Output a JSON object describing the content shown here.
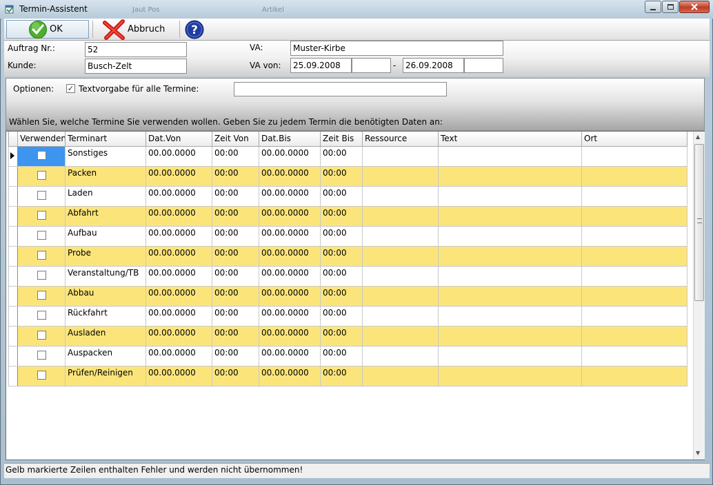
{
  "window": {
    "title": "Termin-Assistent",
    "background_caption_1": "Jaut Pos",
    "background_caption_2": "Artikel"
  },
  "toolbar": {
    "ok_label": "OK",
    "cancel_label": "Abbruch",
    "ok_icon": "green-check-icon",
    "cancel_icon": "red-x-icon",
    "help_icon": "help-question-icon"
  },
  "header": {
    "order_label": "Auftrag Nr.:",
    "order_value": "52",
    "customer_label": "Kunde:",
    "customer_value": "Busch-Zelt",
    "event_label": "VA:",
    "event_value": "Muster-Kirbe",
    "event_from_label": "VA von:",
    "date_from": "25.09.2008",
    "time_from": "",
    "date_separator": "-",
    "date_to": "26.09.2008",
    "time_to": ""
  },
  "options": {
    "label": "Optionen:",
    "text_default_checkbox_label": "Textvorgabe für alle Termine:",
    "text_default_checked": true,
    "text_default_value": "",
    "instruction": "Wählen Sie, welche Termine Sie verwenden wollen. Geben Sie zu jedem Termin die benötigten Daten an:"
  },
  "grid": {
    "columns": [
      "Verwenden",
      "Terminart",
      "Dat.Von",
      "Zeit Von",
      "Dat.Bis",
      "Zeit Bis",
      "Ressource",
      "Text",
      "Ort"
    ],
    "rows": [
      {
        "use": false,
        "type": "Sonstiges",
        "date_from": "00.00.0000",
        "time_from": "00:00",
        "date_to": "00.00.0000",
        "time_to": "00:00",
        "resource": "",
        "text": "",
        "place": ""
      },
      {
        "use": false,
        "type": "Packen",
        "date_from": "00.00.0000",
        "time_from": "00:00",
        "date_to": "00.00.0000",
        "time_to": "00:00",
        "resource": "",
        "text": "",
        "place": ""
      },
      {
        "use": false,
        "type": "Laden",
        "date_from": "00.00.0000",
        "time_from": "00:00",
        "date_to": "00.00.0000",
        "time_to": "00:00",
        "resource": "",
        "text": "",
        "place": ""
      },
      {
        "use": false,
        "type": "Abfahrt",
        "date_from": "00.00.0000",
        "time_from": "00:00",
        "date_to": "00.00.0000",
        "time_to": "00:00",
        "resource": "",
        "text": "",
        "place": ""
      },
      {
        "use": false,
        "type": "Aufbau",
        "date_from": "00.00.0000",
        "time_from": "00:00",
        "date_to": "00.00.0000",
        "time_to": "00:00",
        "resource": "",
        "text": "",
        "place": ""
      },
      {
        "use": false,
        "type": "Probe",
        "date_from": "00.00.0000",
        "time_from": "00:00",
        "date_to": "00.00.0000",
        "time_to": "00:00",
        "resource": "",
        "text": "",
        "place": ""
      },
      {
        "use": false,
        "type": "Veranstaltung/TB",
        "date_from": "00.00.0000",
        "time_from": "00:00",
        "date_to": "00.00.0000",
        "time_to": "00:00",
        "resource": "",
        "text": "",
        "place": ""
      },
      {
        "use": false,
        "type": "Abbau",
        "date_from": "00.00.0000",
        "time_from": "00:00",
        "date_to": "00.00.0000",
        "time_to": "00:00",
        "resource": "",
        "text": "",
        "place": ""
      },
      {
        "use": false,
        "type": "Rückfahrt",
        "date_from": "00.00.0000",
        "time_from": "00:00",
        "date_to": "00.00.0000",
        "time_to": "00:00",
        "resource": "",
        "text": "",
        "place": ""
      },
      {
        "use": false,
        "type": "Ausladen",
        "date_from": "00.00.0000",
        "time_from": "00:00",
        "date_to": "00.00.0000",
        "time_to": "00:00",
        "resource": "",
        "text": "",
        "place": ""
      },
      {
        "use": false,
        "type": "Auspacken",
        "date_from": "00.00.0000",
        "time_from": "00:00",
        "date_to": "00.00.0000",
        "time_to": "00:00",
        "resource": "",
        "text": "",
        "place": ""
      },
      {
        "use": false,
        "type": "Prüfen/Reinigen",
        "date_from": "00.00.0000",
        "time_from": "00:00",
        "date_to": "00.00.0000",
        "time_to": "00:00",
        "resource": "",
        "text": "",
        "place": ""
      }
    ]
  },
  "status": {
    "message": "Gelb markierte Zeilen enthalten Fehler und werden nicht übernommen!"
  },
  "colors": {
    "error_row": "#fbe57b",
    "selection": "#3d95f0"
  }
}
